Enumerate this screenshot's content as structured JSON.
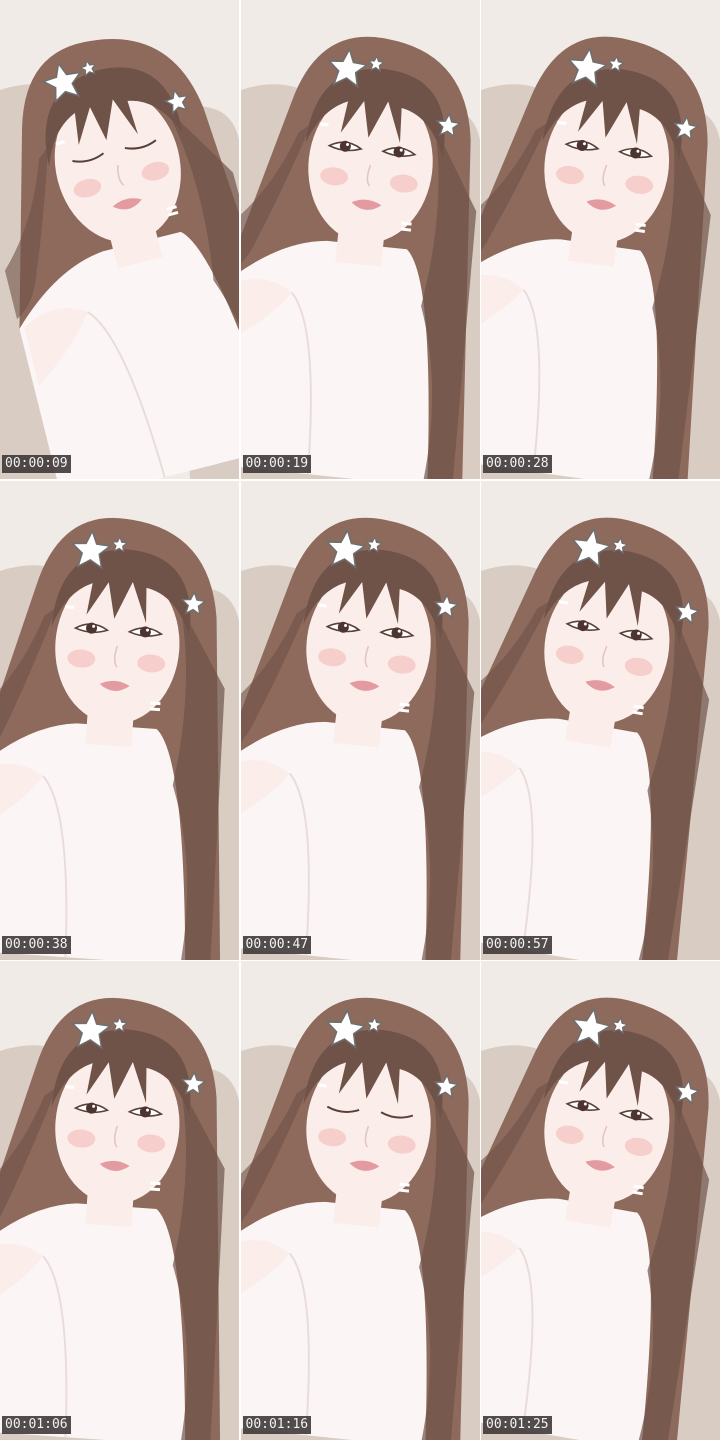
{
  "contact_sheet": {
    "frames": [
      {
        "timestamp": "00:00:09",
        "eyes": "closed",
        "tilt": -14,
        "shift": -6
      },
      {
        "timestamp": "00:00:19",
        "eyes": "open",
        "tilt": 6,
        "shift": 4
      },
      {
        "timestamp": "00:00:28",
        "eyes": "open",
        "tilt": 8,
        "shift": 0
      },
      {
        "timestamp": "00:00:38",
        "eyes": "open",
        "tilt": 4,
        "shift": -8
      },
      {
        "timestamp": "00:00:47",
        "eyes": "open",
        "tilt": 6,
        "shift": 2
      },
      {
        "timestamp": "00:00:57",
        "eyes": "open",
        "tilt": 10,
        "shift": 0
      },
      {
        "timestamp": "00:01:06",
        "eyes": "open",
        "tilt": 4,
        "shift": -8
      },
      {
        "timestamp": "00:01:16",
        "eyes": "closed",
        "tilt": 6,
        "shift": 2
      },
      {
        "timestamp": "00:01:25",
        "eyes": "open",
        "tilt": 10,
        "shift": 0
      }
    ]
  },
  "colors": {
    "wall": "#f1ebe8",
    "sofa": "#d8ccc3",
    "hair": "#8d6a5c",
    "hair_dark": "#6f5248",
    "skin": "#fbeeea",
    "blush": "#f6cfcc",
    "lips": "#e39aa0",
    "shirt": "#fbf6f5",
    "timestamp_bg": "#3a3434",
    "timestamp_fg": "#f3f3f3"
  }
}
